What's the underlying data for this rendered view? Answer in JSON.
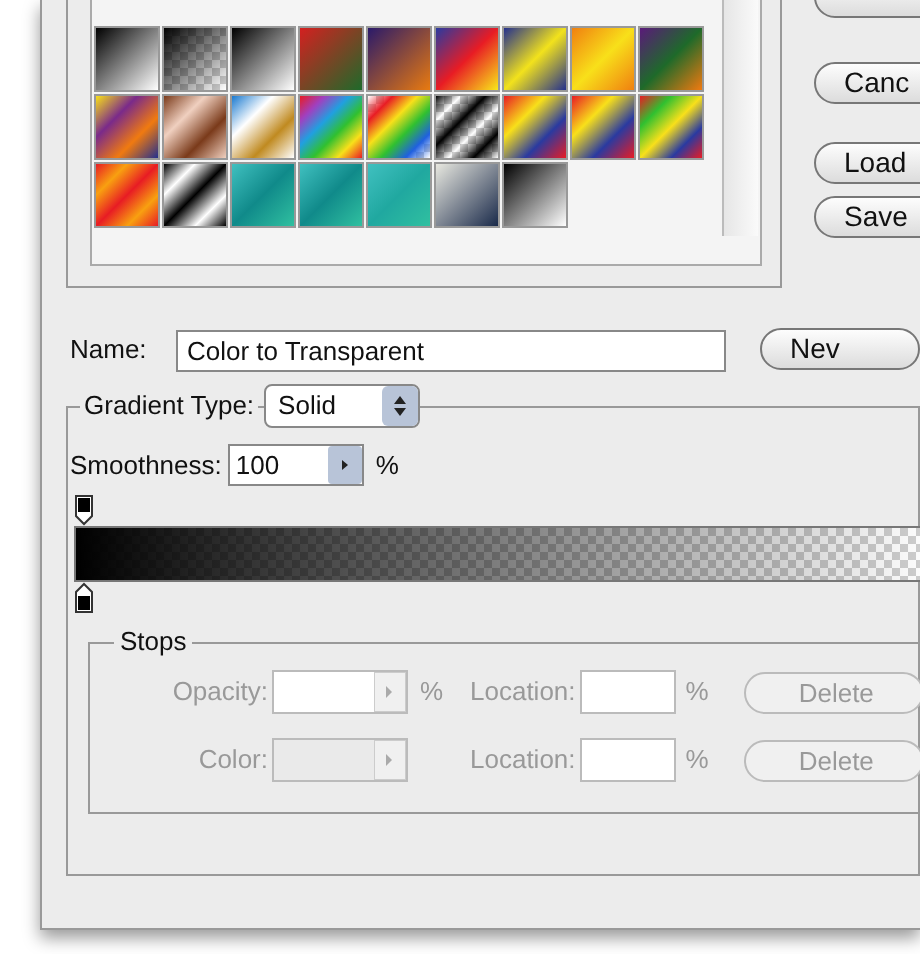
{
  "side_buttons": [
    "Canc",
    "Load",
    "Save"
  ],
  "name": {
    "label": "Name:",
    "value": "Color to Transparent"
  },
  "new_button": "Nev",
  "gradient_type": {
    "label": "Gradient Type:",
    "value": "Solid"
  },
  "smoothness": {
    "label": "Smoothness:",
    "value": "100",
    "unit": "%"
  },
  "gradient": {
    "color": "#000000"
  },
  "stops": {
    "title": "Stops",
    "rows": [
      {
        "label": "Opacity:",
        "unit": "%",
        "location_label": "Location:",
        "location_unit": "%",
        "delete": "Delete",
        "disabled": true
      },
      {
        "label": "Color:",
        "unit": "",
        "location_label": "Location:",
        "location_unit": "%",
        "delete": "Delete",
        "disabled": true
      }
    ]
  }
}
